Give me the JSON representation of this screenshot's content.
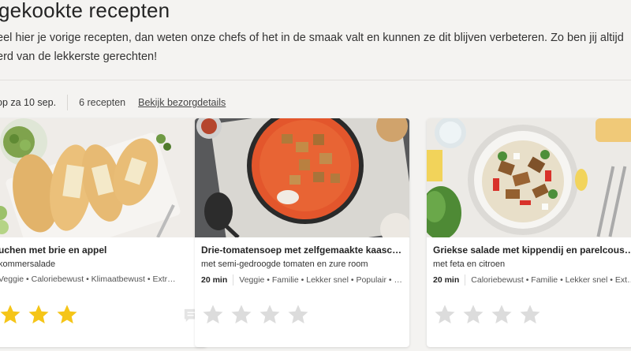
{
  "page": {
    "title": "gekookte recepten",
    "intro_line1": "eel hier je vorige recepten, dan weten onze chefs of het in de smaak valt en kunnen ze dit blijven verbeteren. Zo ben jij altijd",
    "intro_line2": "erd van de lekkerste gerechten!"
  },
  "delivery": {
    "date_label": "op za 10 sep.",
    "count_label": "6 recepten",
    "details_link": "Bekijk bezorgdetails"
  },
  "colors": {
    "star_filled": "#f5c518",
    "star_empty": "#dcdcdc",
    "background": "#f4f3f1"
  },
  "recipes": [
    {
      "title": "uchen met brie en appel",
      "subtitle": "kommersalade",
      "time": "",
      "tags": "Veggie • Calorie­bewust • Klimaatbewust • Extr…",
      "rating": 3,
      "image_icon": "flatbread-photo"
    },
    {
      "title": "Drie-tomatensoep met zelfgemaakte kaascrout…",
      "subtitle": "met semi-gedroogde tomaten en zure room",
      "time": "20 min",
      "tags": "Veggie • Familie • Lekker snel • Populair • Klim…",
      "rating": 0,
      "image_icon": "tomato-soup-photo"
    },
    {
      "title": "Griekse salade met kippendij en parelcouscous",
      "subtitle": "met feta en citroen",
      "time": "20 min",
      "tags": "Caloriebewust • Familie • Lekker snel • Extra g…",
      "rating": 0,
      "image_icon": "greek-salad-photo"
    }
  ]
}
